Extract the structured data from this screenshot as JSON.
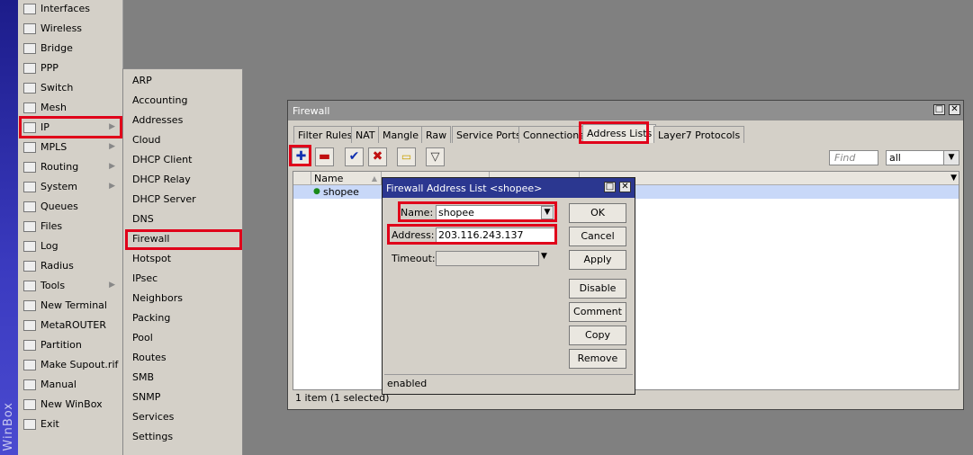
{
  "winbox": {
    "strip_label": "WinBox"
  },
  "main_menu": [
    {
      "label": "Interfaces",
      "icon": "interfaces-icon"
    },
    {
      "label": "Wireless",
      "icon": "wireless-icon"
    },
    {
      "label": "Bridge",
      "icon": "bridge-icon"
    },
    {
      "label": "PPP",
      "icon": "ppp-icon"
    },
    {
      "label": "Switch",
      "icon": "switch-icon"
    },
    {
      "label": "Mesh",
      "icon": "mesh-icon"
    },
    {
      "label": "IP",
      "icon": "ip-icon"
    },
    {
      "label": "MPLS",
      "icon": "mpls-icon"
    },
    {
      "label": "Routing",
      "icon": "routing-icon"
    },
    {
      "label": "System",
      "icon": "system-icon"
    },
    {
      "label": "Queues",
      "icon": "queues-icon"
    },
    {
      "label": "Files",
      "icon": "files-icon"
    },
    {
      "label": "Log",
      "icon": "log-icon"
    },
    {
      "label": "Radius",
      "icon": "radius-icon"
    },
    {
      "label": "Tools",
      "icon": "tools-icon"
    },
    {
      "label": "New Terminal",
      "icon": "terminal-icon"
    },
    {
      "label": "MetaROUTER",
      "icon": "metarouter-icon"
    },
    {
      "label": "Partition",
      "icon": "partition-icon"
    },
    {
      "label": "Make Supout.rif",
      "icon": "supout-icon"
    },
    {
      "label": "Manual",
      "icon": "manual-icon"
    },
    {
      "label": "New WinBox",
      "icon": "winbox-icon"
    },
    {
      "label": "Exit",
      "icon": "exit-icon"
    }
  ],
  "ip_submenu": [
    "ARP",
    "Accounting",
    "Addresses",
    "Cloud",
    "DHCP Client",
    "DHCP Relay",
    "DHCP Server",
    "DNS",
    "Firewall",
    "Hotspot",
    "IPsec",
    "Neighbors",
    "Packing",
    "Pool",
    "Routes",
    "SMB",
    "SNMP",
    "Services",
    "Settings"
  ],
  "firewall": {
    "title": "Firewall",
    "tabs": [
      "Filter Rules",
      "NAT",
      "Mangle",
      "Raw",
      "Service Ports",
      "Connections",
      "Address Lists",
      "Layer7 Protocols"
    ],
    "active_tab": "Address Lists",
    "find_placeholder": "Find",
    "filter_value": "all",
    "columns": [
      "Name"
    ],
    "rows": [
      {
        "name": "shopee"
      }
    ],
    "status": "1 item (1 selected)",
    "colors": {
      "add": "#1030b0",
      "remove": "#c01010",
      "check": "#1030b0",
      "cross": "#c01010"
    }
  },
  "dialog": {
    "title": "Firewall Address List <shopee>",
    "name_label": "Name:",
    "name_value": "shopee",
    "address_label": "Address:",
    "address_value": "203.116.243.137",
    "timeout_label": "Timeout:",
    "buttons": [
      "OK",
      "Cancel",
      "Apply",
      "Disable",
      "Comment",
      "Copy",
      "Remove"
    ],
    "status": "enabled"
  },
  "highlight_color": "#e0001a"
}
